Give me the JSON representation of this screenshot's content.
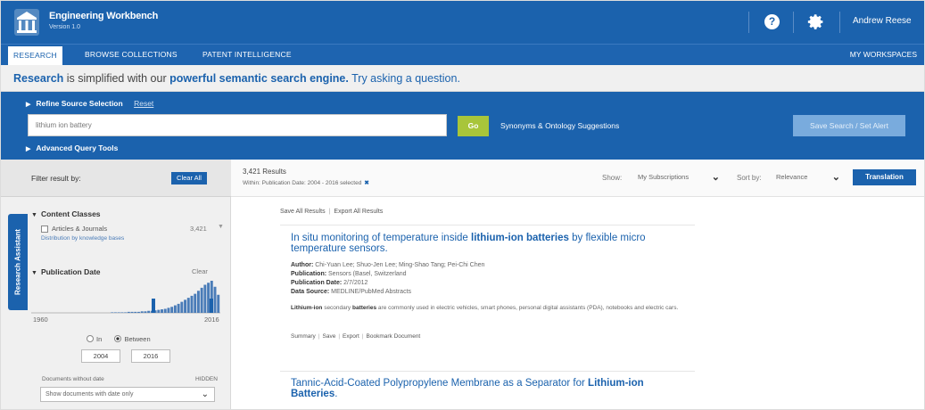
{
  "header": {
    "app_title": "Engineering Workbench",
    "app_version": "Version 1.0",
    "user_name": "Andrew Reese",
    "help_glyph": "?",
    "icons": [
      "building-logo-icon",
      "help-icon",
      "gear-icon"
    ]
  },
  "tabs": [
    {
      "label": "RESEARCH",
      "active": true
    },
    {
      "label": "BROWSE COLLECTIONS",
      "active": false
    },
    {
      "label": "PATENT INTELLIGENCE",
      "active": false
    }
  ],
  "my_workspaces": "MY WORKSPACES",
  "tagline": {
    "part1": "Research",
    "part2": " is simplified with our ",
    "part3": "powerful semantic search engine.",
    "part4": " Try asking a question."
  },
  "search": {
    "refine_label": "Refine Source Selection",
    "refine_reset": "Reset",
    "query_value": "lithium ion battery",
    "go_label": "Go",
    "synonyms_label": "Synonyms & Ontology Suggestions",
    "save_search_label": "Save Search / Set Alert",
    "advanced_label": "Advanced Query Tools"
  },
  "filter": {
    "title": "Filter result by:",
    "clear_all": "Clear All",
    "research_assistant": "Research Assistant",
    "content_classes": {
      "title": "Content Classes",
      "item_label": "Articles & Journals",
      "item_count": "3,421",
      "item_sub": "Distribution by knowledge bases"
    },
    "publication_date": {
      "title": "Publication Date",
      "clear": "Clear",
      "start_year": "1960",
      "end_year": "2016",
      "radio_in": "In",
      "radio_between": "Between",
      "selected": "Between",
      "from_value": "2004",
      "to_value": "2016",
      "histogram": [
        0,
        0,
        0,
        0,
        0,
        0,
        0,
        0,
        0,
        0,
        0,
        0,
        0,
        0,
        0,
        0,
        0,
        0,
        0,
        0,
        0,
        0,
        0,
        0,
        1,
        1,
        1,
        1,
        1,
        2,
        2,
        2,
        2,
        3,
        3,
        4,
        4,
        5,
        6,
        7,
        8,
        10,
        12,
        15,
        18,
        22,
        26,
        30,
        34,
        38,
        44,
        50,
        56,
        60,
        64,
        52,
        36
      ]
    },
    "documents": {
      "label": "Documents without date",
      "value": "HIDDEN",
      "select_value": "Show documents with date only"
    }
  },
  "results_bar": {
    "count": "3,421 Results",
    "within": "Within: Publication Date: 2004 - 2016 selected",
    "show_label": "Show:",
    "show_value": "My Subscriptions",
    "sort_label": "Sort by:",
    "sort_value": "Relevance",
    "translation": "Translation"
  },
  "results_actions": {
    "save_all": "Save All Results",
    "export_all": "Export All Results"
  },
  "results": [
    {
      "title_pre": "In situ monitoring of temperature inside ",
      "title_bold": "lithium-ion batteries",
      "title_post": " by flexible micro temperature sensors.",
      "author_label": "Author:",
      "author": "Chi-Yuan Lee; Shuo-Jen Lee; Ming-Shao Tang; Pei-Chi Chen",
      "publication_label": "Publication:",
      "publication": "Sensors (Basel, Switzerland",
      "date_label": "Publication Date:",
      "date": "2/7/2012",
      "source_label": "Data Source:",
      "source": "MEDLINE/PubMed Abstracts",
      "snippet_bold1": "Lithium-ion",
      "snippet_mid": " secondary ",
      "snippet_bold2": "batteries",
      "snippet_rest": " are commonly used in electric vehicles, smart phones, personal digital assistants (PDA), notebooks and electric cars.",
      "actions": [
        "Summary",
        "Save",
        "Export",
        "Bookmark Document"
      ]
    },
    {
      "title_pre": "Tannic-Acid-Coated Polypropylene Membrane as a Separator for ",
      "title_bold": "Lithium-ion Batteries",
      "title_post": "."
    }
  ]
}
